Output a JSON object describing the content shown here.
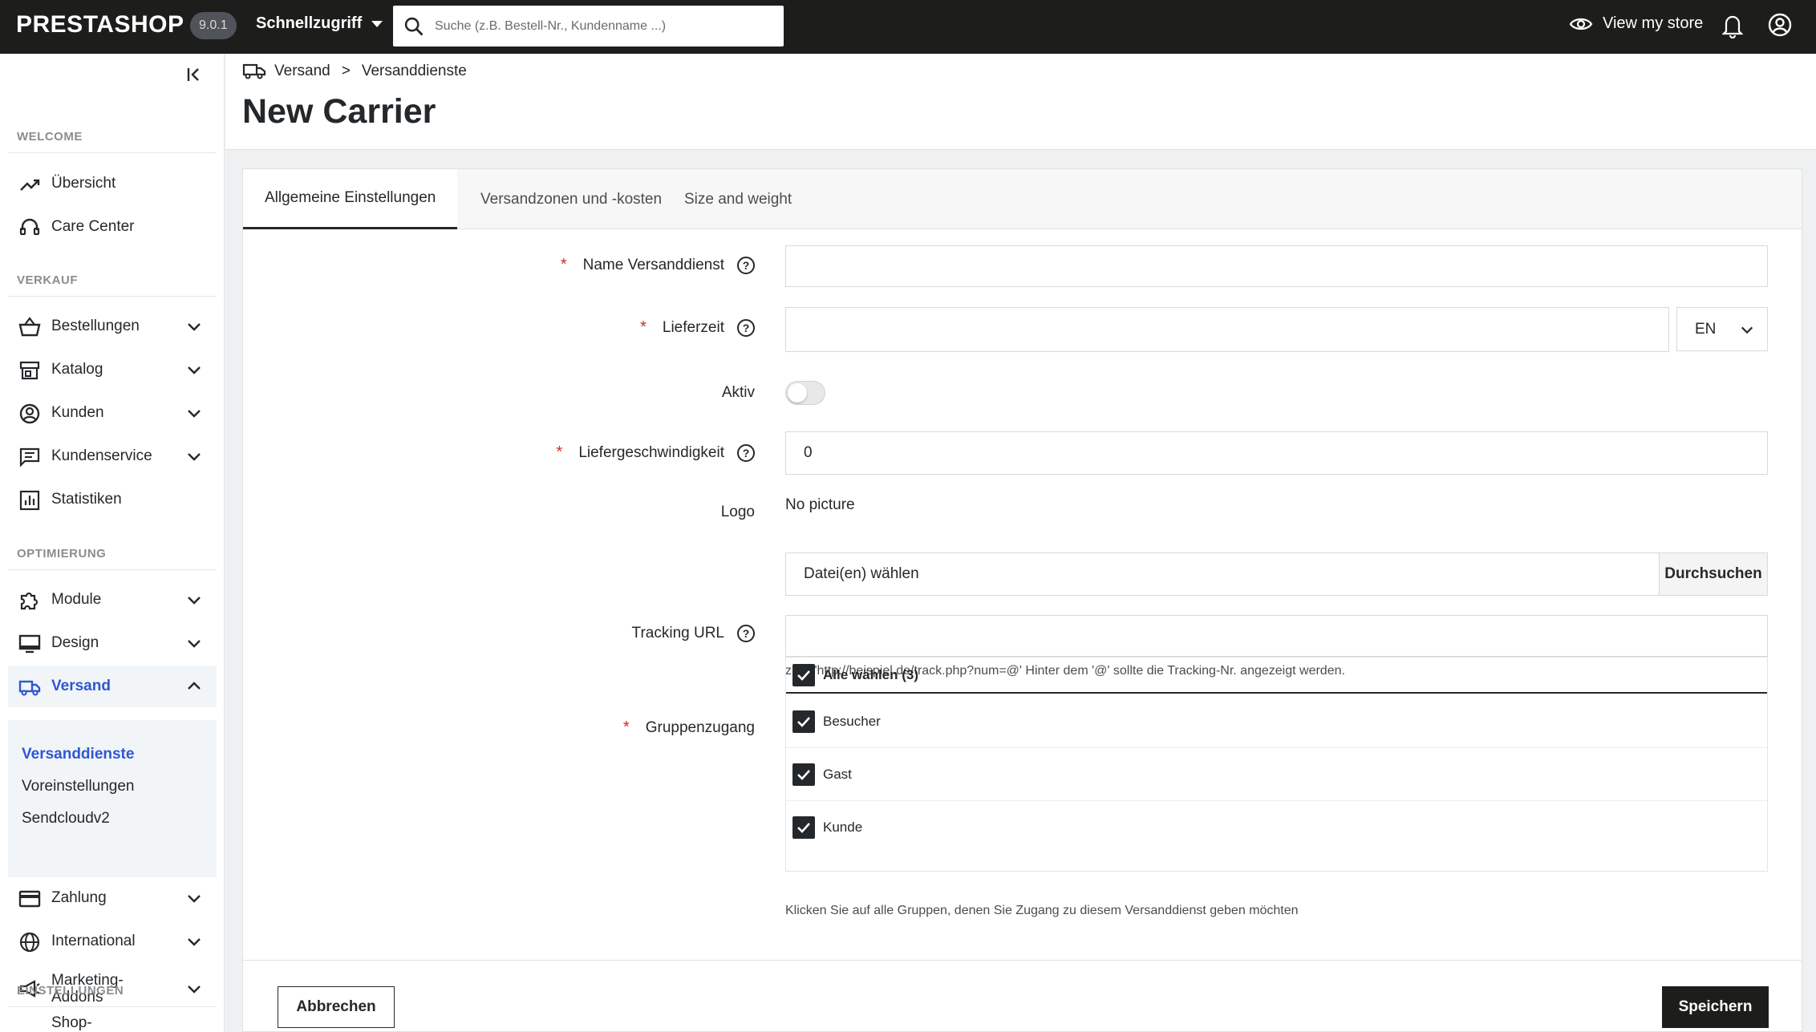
{
  "topbar": {
    "brand": "PRESTASHOP",
    "version": "9.0.1",
    "quick_access": "Schnellzugriff",
    "search_placeholder": "Suche (z.B. Bestell-Nr., Kundenname ...)",
    "view_store": "View my store"
  },
  "sidebar": {
    "sections": {
      "welcome": "WELCOME",
      "verkauf": "VERKAUF",
      "optimierung": "OPTIMIERUNG",
      "einstellungen": "EINSTELLUNGEN"
    },
    "items": {
      "uebersicht": "Übersicht",
      "care_center": "Care Center",
      "bestellungen": "Bestellungen",
      "katalog": "Katalog",
      "kunden": "Kunden",
      "kundenservice": "Kundenservice",
      "statistiken": "Statistiken",
      "module": "Module",
      "design": "Design",
      "versand": "Versand",
      "zahlung": "Zahlung",
      "international": "International",
      "marketing_1": "Marketing-",
      "marketing_2": "Addons",
      "shop_partial": "Shop-"
    },
    "subitems": {
      "versanddienste": "Versanddienste",
      "voreinstellungen": "Voreinstellungen",
      "sendcloud": "Sendcloudv2"
    }
  },
  "header": {
    "breadcrumb_parent": "Versand",
    "breadcrumb_separator": ">",
    "breadcrumb_current": "Versanddienste",
    "title": "New Carrier"
  },
  "tabs": {
    "general": "Allgemeine Einstellungen",
    "zones": "Versandzonen und -kosten",
    "size": "Size and weight"
  },
  "form": {
    "required_mark": "*",
    "help_glyph": "?",
    "name_label": "Name Versanddienst",
    "name_value": "",
    "delay_label": "Lieferzeit",
    "delay_value": "",
    "language": "EN",
    "active_label": "Aktiv",
    "active": false,
    "speed_label": "Liefergeschwindigkeit",
    "speed_value": "0",
    "logo_label": "Logo",
    "logo_value": "No picture",
    "file_placeholder": "Datei(en) wählen",
    "browse": "Durchsuchen",
    "tracking_label": "Tracking URL",
    "tracking_value": "",
    "tracking_hint": "z.B.: 'http://beispiel.de/track.php?num=@' Hinter dem '@' sollte die Tracking-Nr. angezeigt werden.",
    "groups_label": "Gruppenzugang",
    "select_all": "Alle wählen (3)",
    "groups": [
      "Besucher",
      "Gast",
      "Kunde"
    ],
    "groups_hint": "Klicken Sie auf alle Gruppen, denen Sie Zugang zu diesem Versanddienst geben möchten"
  },
  "actions": {
    "cancel": "Abbrechen",
    "save": "Speichern"
  },
  "colors": {
    "topbar": "#1d1d1b",
    "accent": "#2f57d3",
    "required": "#d02a2a"
  }
}
